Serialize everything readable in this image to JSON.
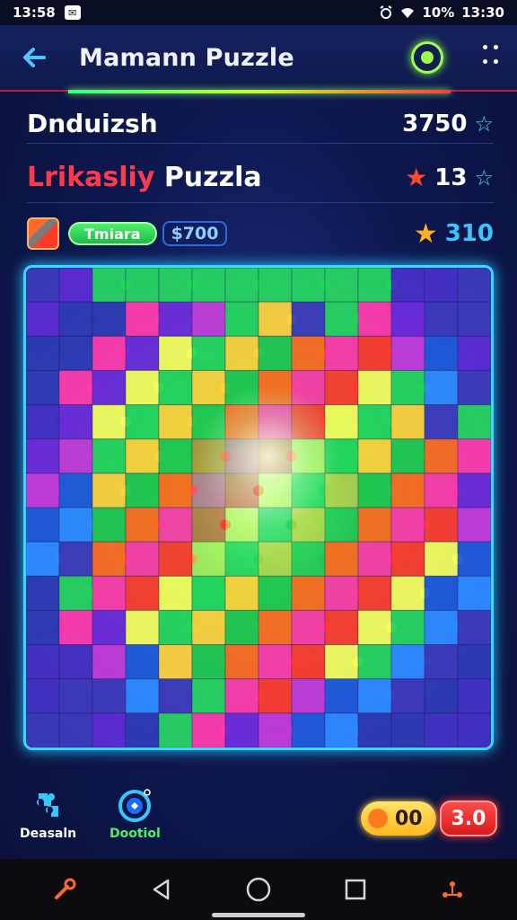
{
  "status_bar": {
    "time_left": "13:58",
    "battery": "10%",
    "time_right": "13:30"
  },
  "app_bar": {
    "title": "Mamann Puzzle"
  },
  "info": {
    "row1_label": "Dnduizsh",
    "row1_score": "3750",
    "row2_label_red": "Lrikasliy",
    "row2_label_white": " Puzzla",
    "row2_count": "13",
    "row3_pill": "Tmiara",
    "row3_value": "$700",
    "row3_number": "310"
  },
  "colors": {
    "accent_cyan": "#3ad8ff",
    "accent_green": "#4cf26a",
    "accent_red": "#ff3b4a",
    "accent_gold": "#ffb020"
  },
  "controls": {
    "left_label": "Deasaln",
    "mid_label": "Dootiol",
    "coins": "00",
    "multiplier": "3.0"
  },
  "icons": {
    "back": "arrow-left-icon",
    "power": "power-icon",
    "more": "more-grid-icon",
    "star": "star-icon",
    "puzzle": "puzzle-piece-icon",
    "hint": "hint-target-icon",
    "coin": "coin-icon",
    "nav_back": "triangle-back-icon",
    "nav_home": "circle-home-icon",
    "nav_recent": "square-recent-icon"
  }
}
